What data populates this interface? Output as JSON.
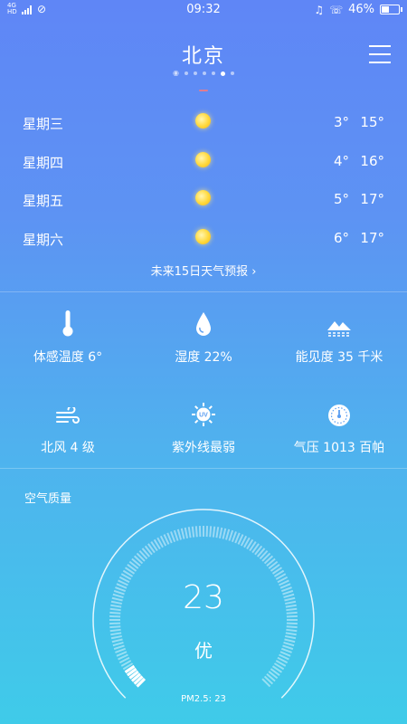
{
  "status_bar": {
    "network": "4G HD",
    "time": "09:32",
    "battery": "46%",
    "battery_level": 0.46
  },
  "header": {
    "city": "北京",
    "page_count": 6,
    "active_page": 5
  },
  "forecast": [
    {
      "day": "星期三",
      "low": "3°",
      "high": "15°",
      "icon": "sun-icon"
    },
    {
      "day": "星期四",
      "low": "4°",
      "high": "16°",
      "icon": "sun-icon"
    },
    {
      "day": "星期五",
      "low": "5°",
      "high": "17°",
      "icon": "sun-icon"
    },
    {
      "day": "星期六",
      "low": "6°",
      "high": "17°",
      "icon": "sun-icon"
    }
  ],
  "more_link": "未来15日天气预报 ›",
  "details": [
    {
      "label": "体感温度 6°",
      "icon": "thermometer-icon"
    },
    {
      "label": "湿度 22%",
      "icon": "water-drop-icon"
    },
    {
      "label": "能见度 35 千米",
      "icon": "visibility-icon"
    },
    {
      "label": "北风 4 级",
      "icon": "wind-icon"
    },
    {
      "label": "紫外线最弱",
      "icon": "uv-sun-icon"
    },
    {
      "label": "气压 1013 百帕",
      "icon": "pressure-gauge-icon"
    }
  ],
  "air_quality": {
    "title": "空气质量",
    "aqi": "23",
    "aqi_value": 23,
    "aqi_max": 500,
    "level": "优",
    "pm25": "PM2.5:  23"
  },
  "colors": {
    "bg_top": "#5f86f6",
    "bg_bottom": "#3fcbe9",
    "sun": "#ffd83a"
  }
}
